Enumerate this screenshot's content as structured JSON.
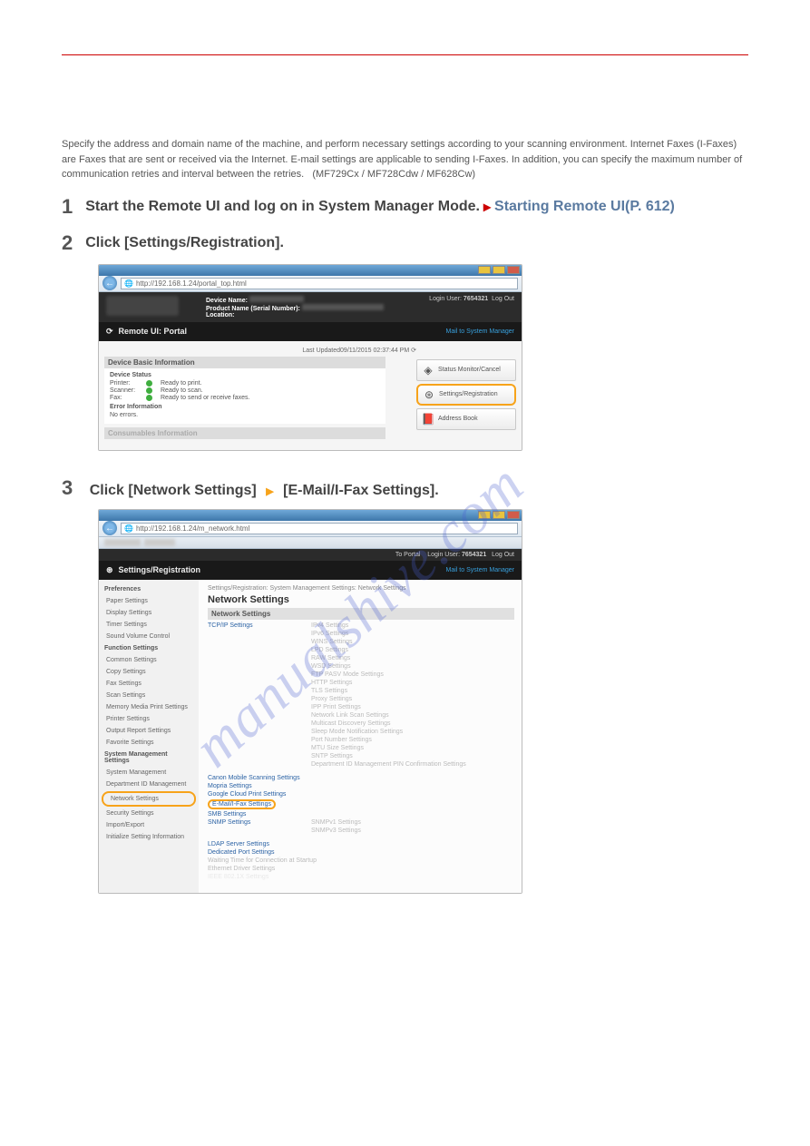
{
  "intro": {
    "para1_a": "Specify the address and domain name of the machine, and perform necessary settings according to your scanning environment. Internet Faxes (I-Faxes) are Faxes that are sent or received via the Internet. E-mail settings are applicable to sending I-Faxes. In addition, you can specify the maximum number of communication retries and interval between the retries. ",
    "para1_b": " (MF729Cx / MF728Cdw / MF628Cw)"
  },
  "steps": {
    "s1_a": "Start the Remote UI and log on in System Manager Mode. ",
    "s1_link": "Starting Remote UI(P. 612)",
    "s2": "Click [Settings/Registration].",
    "s3_a": "Click [Network Settings] ",
    "s3_b": " [E-Mail/I-Fax Settings].",
    "step_nums": {
      "n1": "1",
      "n2": "2",
      "n3": "3"
    }
  },
  "shot1": {
    "url": "http://192.168.1.24/portal_top.html",
    "device_labels": {
      "dn": "Device Name:",
      "pn": "Product Name (Serial Number):",
      "loc": "Location:"
    },
    "login_user_label": "Login User:",
    "login_user": "7654321",
    "logout": "Log Out",
    "portal": "Remote UI: Portal",
    "mail": "Mail to System Manager",
    "lastupd": "Last Updated09/11/2015 02:37:44 PM",
    "basic_head": "Device Basic Information",
    "device_status": "Device Status",
    "printer_l": "Printer:",
    "printer_v": "Ready to print.",
    "scanner_l": "Scanner:",
    "scanner_v": "Ready to scan.",
    "fax_l": "Fax:",
    "fax_v": "Ready to send or receive faxes.",
    "err_head": "Error Information",
    "err_v": "No errors.",
    "consum": "Consumables Information",
    "btns": {
      "a": "Status Monitor/Cancel",
      "b": "Settings/Registration",
      "c": "Address Book"
    }
  },
  "shot2": {
    "url": "http://192.168.1.24/m_network.html",
    "to_portal": "To Portal",
    "login_user_label": "Login User:",
    "login_user": "7654321",
    "logout": "Log Out",
    "bar": "Settings/Registration",
    "mail": "Mail to System Manager",
    "left": {
      "pref": "Preferences",
      "paper": "Paper Settings",
      "display": "Display Settings",
      "timer": "Timer Settings",
      "sound": "Sound Volume Control",
      "func": "Function Settings",
      "common": "Common Settings",
      "copy": "Copy Settings",
      "faxs": "Fax Settings",
      "scan": "Scan Settings",
      "mem": "Memory Media Print Settings",
      "printer": "Printer Settings",
      "out": "Output Report Settings",
      "fav": "Favorite Settings",
      "sys": "System Management Settings",
      "sysm": "System Management",
      "dept": "Department ID Management",
      "net": "Network Settings",
      "sec": "Security Settings",
      "imp": "Import/Export",
      "init": "Initialize Setting Information"
    },
    "right": {
      "bc": "Settings/Registration: System Management Settings: Network Settings",
      "title": "Network Settings",
      "strip": "Network Settings",
      "tcpip": "TCP/IP Settings",
      "sub": [
        "IPv4 Settings",
        "IPv6 Settings",
        "WINS Settings",
        "LPD Settings",
        "RAW Settings",
        "WSD Settings",
        "FTP PASV Mode Settings",
        "HTTP Settings",
        "TLS Settings",
        "Proxy Settings",
        "IPP Print Settings",
        "Network Link Scan Settings",
        "Multicast Discovery Settings",
        "Sleep Mode Notification Settings",
        "Port Number Settings",
        "MTU Size Settings",
        "SNTP Settings",
        "Department ID Management PIN Confirmation Settings"
      ],
      "lnks": {
        "canon": "Canon Mobile Scanning Settings",
        "mopria": "Mopria Settings",
        "google": "Google Cloud Print Settings",
        "email": "E-Mail/I-Fax Settings",
        "smb": "SMB Settings",
        "snmp": "SNMP Settings",
        "sn1": "SNMPv1 Settings",
        "sn2": "SNMPv3 Settings",
        "ldap": "LDAP Server Settings",
        "ded": "Dedicated Port Settings",
        "wait": "Waiting Time for Connection at Startup",
        "eth": "Ethernet Driver Settings",
        "ieee": "IEEE 802.1X Settings"
      }
    }
  },
  "watermark": "manualshive.com"
}
